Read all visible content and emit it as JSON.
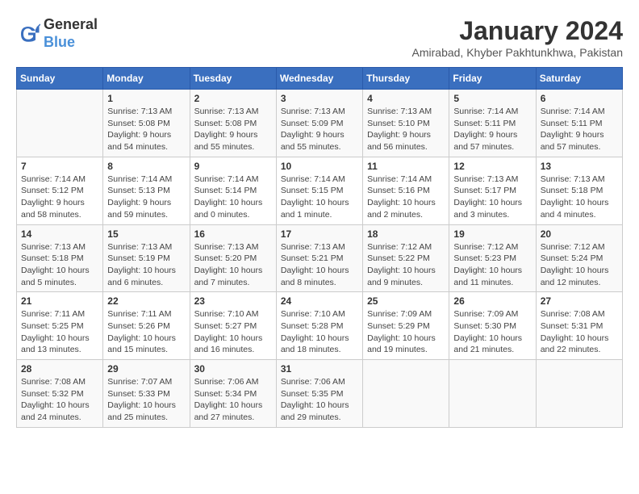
{
  "logo": {
    "line1": "General",
    "line2": "Blue"
  },
  "title": "January 2024",
  "subtitle": "Amirabad, Khyber Pakhtunkhwa, Pakistan",
  "days_of_week": [
    "Sunday",
    "Monday",
    "Tuesday",
    "Wednesday",
    "Thursday",
    "Friday",
    "Saturday"
  ],
  "weeks": [
    [
      {
        "day": "",
        "info": ""
      },
      {
        "day": "1",
        "info": "Sunrise: 7:13 AM\nSunset: 5:08 PM\nDaylight: 9 hours\nand 54 minutes."
      },
      {
        "day": "2",
        "info": "Sunrise: 7:13 AM\nSunset: 5:08 PM\nDaylight: 9 hours\nand 55 minutes."
      },
      {
        "day": "3",
        "info": "Sunrise: 7:13 AM\nSunset: 5:09 PM\nDaylight: 9 hours\nand 55 minutes."
      },
      {
        "day": "4",
        "info": "Sunrise: 7:13 AM\nSunset: 5:10 PM\nDaylight: 9 hours\nand 56 minutes."
      },
      {
        "day": "5",
        "info": "Sunrise: 7:14 AM\nSunset: 5:11 PM\nDaylight: 9 hours\nand 57 minutes."
      },
      {
        "day": "6",
        "info": "Sunrise: 7:14 AM\nSunset: 5:11 PM\nDaylight: 9 hours\nand 57 minutes."
      }
    ],
    [
      {
        "day": "7",
        "info": "Sunrise: 7:14 AM\nSunset: 5:12 PM\nDaylight: 9 hours\nand 58 minutes."
      },
      {
        "day": "8",
        "info": "Sunrise: 7:14 AM\nSunset: 5:13 PM\nDaylight: 9 hours\nand 59 minutes."
      },
      {
        "day": "9",
        "info": "Sunrise: 7:14 AM\nSunset: 5:14 PM\nDaylight: 10 hours\nand 0 minutes."
      },
      {
        "day": "10",
        "info": "Sunrise: 7:14 AM\nSunset: 5:15 PM\nDaylight: 10 hours\nand 1 minute."
      },
      {
        "day": "11",
        "info": "Sunrise: 7:14 AM\nSunset: 5:16 PM\nDaylight: 10 hours\nand 2 minutes."
      },
      {
        "day": "12",
        "info": "Sunrise: 7:13 AM\nSunset: 5:17 PM\nDaylight: 10 hours\nand 3 minutes."
      },
      {
        "day": "13",
        "info": "Sunrise: 7:13 AM\nSunset: 5:18 PM\nDaylight: 10 hours\nand 4 minutes."
      }
    ],
    [
      {
        "day": "14",
        "info": "Sunrise: 7:13 AM\nSunset: 5:18 PM\nDaylight: 10 hours\nand 5 minutes."
      },
      {
        "day": "15",
        "info": "Sunrise: 7:13 AM\nSunset: 5:19 PM\nDaylight: 10 hours\nand 6 minutes."
      },
      {
        "day": "16",
        "info": "Sunrise: 7:13 AM\nSunset: 5:20 PM\nDaylight: 10 hours\nand 7 minutes."
      },
      {
        "day": "17",
        "info": "Sunrise: 7:13 AM\nSunset: 5:21 PM\nDaylight: 10 hours\nand 8 minutes."
      },
      {
        "day": "18",
        "info": "Sunrise: 7:12 AM\nSunset: 5:22 PM\nDaylight: 10 hours\nand 9 minutes."
      },
      {
        "day": "19",
        "info": "Sunrise: 7:12 AM\nSunset: 5:23 PM\nDaylight: 10 hours\nand 11 minutes."
      },
      {
        "day": "20",
        "info": "Sunrise: 7:12 AM\nSunset: 5:24 PM\nDaylight: 10 hours\nand 12 minutes."
      }
    ],
    [
      {
        "day": "21",
        "info": "Sunrise: 7:11 AM\nSunset: 5:25 PM\nDaylight: 10 hours\nand 13 minutes."
      },
      {
        "day": "22",
        "info": "Sunrise: 7:11 AM\nSunset: 5:26 PM\nDaylight: 10 hours\nand 15 minutes."
      },
      {
        "day": "23",
        "info": "Sunrise: 7:10 AM\nSunset: 5:27 PM\nDaylight: 10 hours\nand 16 minutes."
      },
      {
        "day": "24",
        "info": "Sunrise: 7:10 AM\nSunset: 5:28 PM\nDaylight: 10 hours\nand 18 minutes."
      },
      {
        "day": "25",
        "info": "Sunrise: 7:09 AM\nSunset: 5:29 PM\nDaylight: 10 hours\nand 19 minutes."
      },
      {
        "day": "26",
        "info": "Sunrise: 7:09 AM\nSunset: 5:30 PM\nDaylight: 10 hours\nand 21 minutes."
      },
      {
        "day": "27",
        "info": "Sunrise: 7:08 AM\nSunset: 5:31 PM\nDaylight: 10 hours\nand 22 minutes."
      }
    ],
    [
      {
        "day": "28",
        "info": "Sunrise: 7:08 AM\nSunset: 5:32 PM\nDaylight: 10 hours\nand 24 minutes."
      },
      {
        "day": "29",
        "info": "Sunrise: 7:07 AM\nSunset: 5:33 PM\nDaylight: 10 hours\nand 25 minutes."
      },
      {
        "day": "30",
        "info": "Sunrise: 7:06 AM\nSunset: 5:34 PM\nDaylight: 10 hours\nand 27 minutes."
      },
      {
        "day": "31",
        "info": "Sunrise: 7:06 AM\nSunset: 5:35 PM\nDaylight: 10 hours\nand 29 minutes."
      },
      {
        "day": "",
        "info": ""
      },
      {
        "day": "",
        "info": ""
      },
      {
        "day": "",
        "info": ""
      }
    ]
  ]
}
